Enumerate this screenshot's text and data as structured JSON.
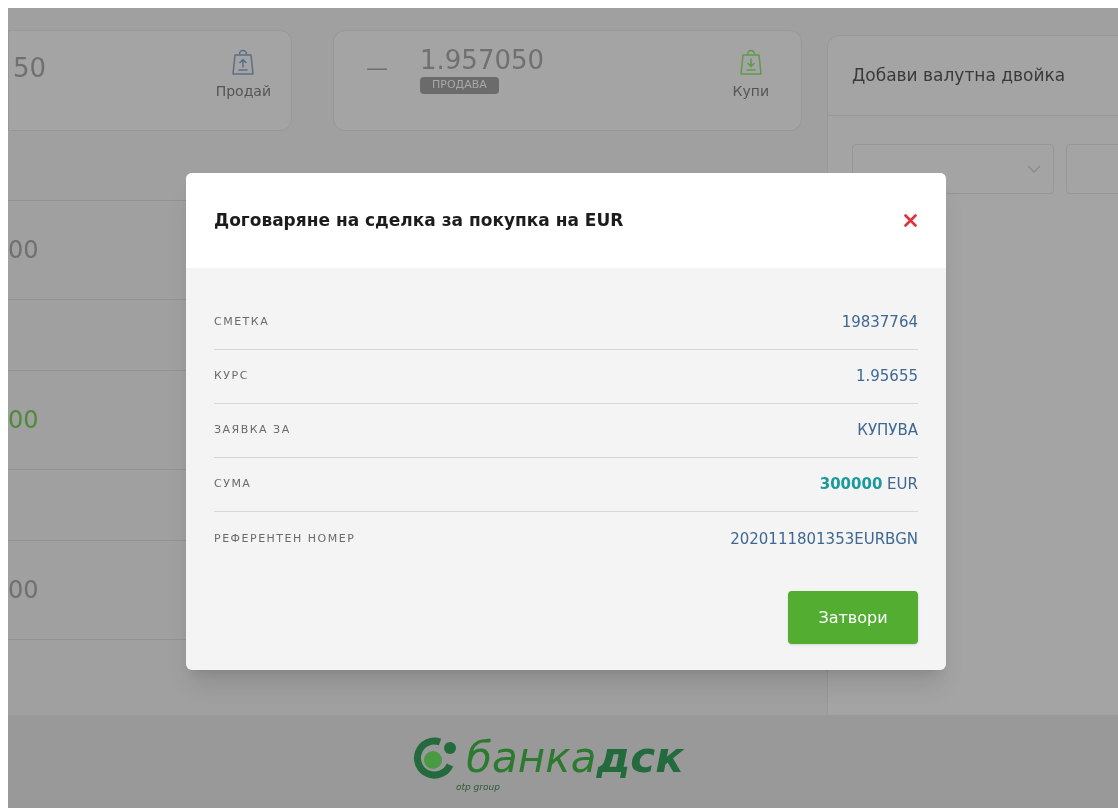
{
  "background": {
    "rate_cards": [
      {
        "kind": "sell",
        "value": "50",
        "action": "Продай"
      },
      {
        "kind": "buy",
        "dash": "—",
        "value": "1.957050",
        "badge": "ПРОДАВА",
        "action": "Купи"
      }
    ],
    "add_pair_panel": {
      "title": "Добави валутна двойка"
    },
    "list_values": [
      {
        "text": "00",
        "highlighted": false
      },
      {
        "text": "00",
        "highlighted": true
      },
      {
        "text": "00",
        "highlighted": false
      }
    ]
  },
  "dialog": {
    "title": "Договаряне на сделка за покупка на EUR",
    "rows": [
      {
        "label": "СМЕТКА",
        "value": "19837764"
      },
      {
        "label": "КУРС",
        "value": "1.95655"
      },
      {
        "label": "ЗАЯВКА ЗА",
        "value": "КУПУВА"
      },
      {
        "label": "СУМА",
        "value": "**300000** EUR"
      },
      {
        "label": "РЕФЕРЕНТЕН НОМЕР",
        "value": "2020111801353EURBGN"
      }
    ],
    "button": "Затвори"
  },
  "footer": {
    "logo_light": "банка",
    "logo_bold": "дск",
    "logo_sub": "otp group"
  }
}
